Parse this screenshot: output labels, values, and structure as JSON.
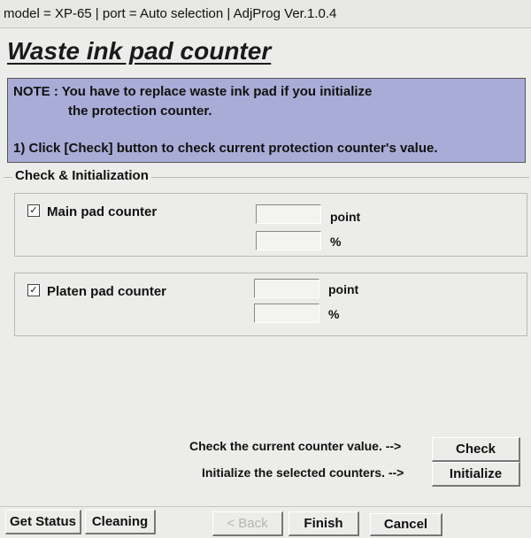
{
  "titlebar": {
    "text": "model = XP-65 | port = Auto selection | AdjProg Ver.1.0.4"
  },
  "page": {
    "heading": "Waste ink pad counter"
  },
  "note": {
    "line1": "NOTE : You have to replace waste ink pad if you initialize",
    "line2": "the protection counter.",
    "line3": "1) Click [Check] button to check current protection counter's value."
  },
  "group": {
    "title": "Check & Initialization",
    "main_pad": {
      "label": "Main pad counter",
      "checked": true,
      "check_mark": "✓",
      "point_value": "",
      "percent_value": "",
      "point_unit": "point",
      "percent_unit": "%"
    },
    "platen_pad": {
      "label": "Platen pad counter",
      "checked": true,
      "check_mark": "✓",
      "point_value": "",
      "percent_value": "",
      "point_unit": "point",
      "percent_unit": "%"
    }
  },
  "actions": {
    "check_hint": "Check the current counter value. -->",
    "check_label": "Check",
    "init_hint": "Initialize the selected counters. -->",
    "init_label": "Initialize"
  },
  "footer": {
    "get_status": "Get Status",
    "cleaning": "Cleaning",
    "back": "< Back",
    "finish": "Finish",
    "cancel": "Cancel"
  }
}
